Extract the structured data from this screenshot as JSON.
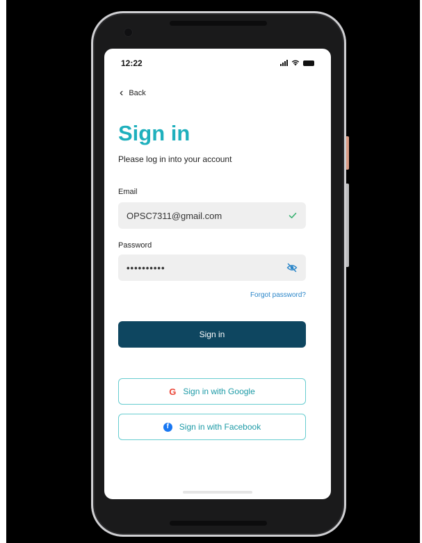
{
  "status_bar": {
    "time": "12:22"
  },
  "nav": {
    "back_label": "Back"
  },
  "header": {
    "title": "Sign in",
    "subtitle": "Please log in into your account"
  },
  "form": {
    "email_label": "Email",
    "email_value": "OPSC7311@gmail.com",
    "password_label": "Password",
    "password_value": "••••••••••",
    "forgot_password": "Forgot password?",
    "signin_label": "Sign in"
  },
  "social": {
    "google_label": "Sign in with Google",
    "facebook_label": "Sign in with Facebook"
  },
  "colors": {
    "title": "#1fb0bd",
    "primary_button": "#0e4660",
    "link": "#2b86c9",
    "social_border": "#66cccf",
    "check": "#3bb273",
    "eye": "#2b86c9"
  },
  "icons": [
    "back-chevron-icon",
    "check-icon",
    "eye-slash-icon",
    "google-icon",
    "facebook-icon"
  ]
}
